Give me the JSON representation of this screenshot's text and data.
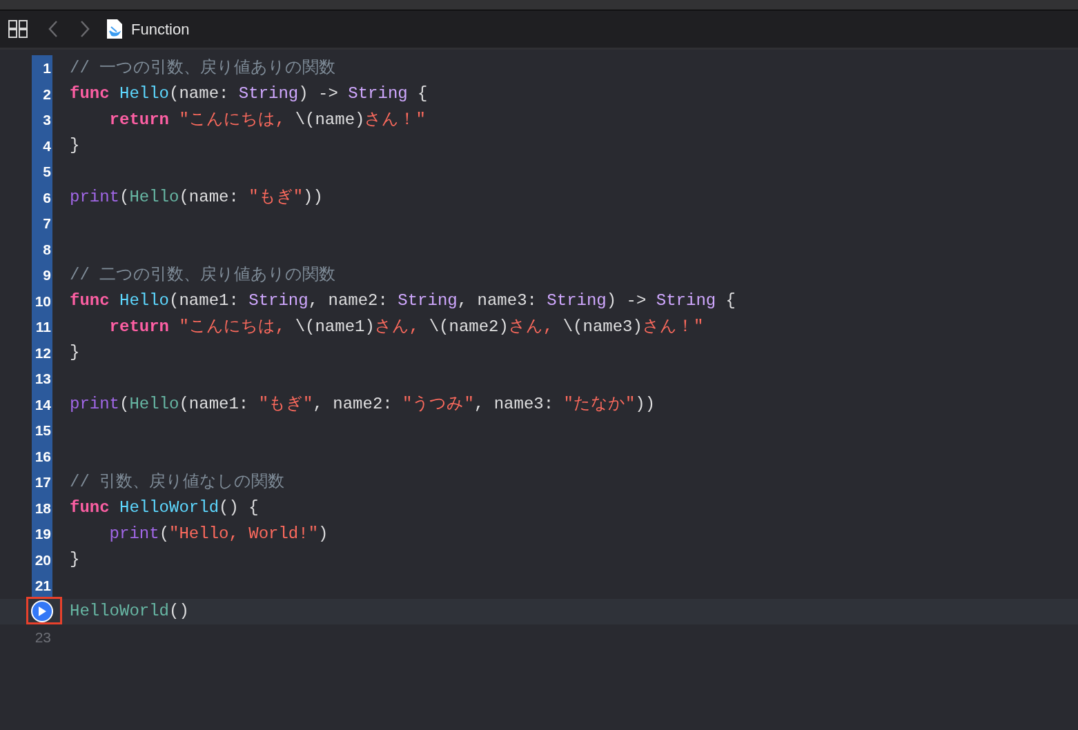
{
  "toolbar": {
    "title": "Function"
  },
  "lines": [
    {
      "number": "1",
      "executed": true,
      "kind": "number",
      "tokens": [
        {
          "kind": "comment",
          "text": "// 一つの引数、戻り値ありの関数"
        }
      ]
    },
    {
      "number": "2",
      "executed": true,
      "kind": "number",
      "tokens": [
        {
          "kind": "keyword",
          "text": "func"
        },
        {
          "kind": "decl",
          "text": " Hello"
        },
        {
          "kind": "plain",
          "text": "(name: "
        },
        {
          "kind": "type",
          "text": "String"
        },
        {
          "kind": "plain",
          "text": ") -> "
        },
        {
          "kind": "type",
          "text": "String"
        },
        {
          "kind": "plain",
          "text": " {"
        }
      ]
    },
    {
      "number": "3",
      "executed": true,
      "kind": "number",
      "tokens": [
        {
          "kind": "keyword",
          "text": "    return"
        },
        {
          "kind": "string",
          "text": " \"こんにちは, "
        },
        {
          "kind": "plain",
          "text": "\\(name)"
        },
        {
          "kind": "string",
          "text": "さん！\""
        }
      ]
    },
    {
      "number": "4",
      "executed": true,
      "kind": "number",
      "tokens": [
        {
          "kind": "plain",
          "text": "}"
        }
      ]
    },
    {
      "number": "5",
      "executed": true,
      "kind": "number"
    },
    {
      "number": "6",
      "executed": true,
      "kind": "number",
      "tokens": [
        {
          "kind": "builtin",
          "text": "print"
        },
        {
          "kind": "plain",
          "text": "("
        },
        {
          "kind": "call",
          "text": "Hello"
        },
        {
          "kind": "plain",
          "text": "(name: "
        },
        {
          "kind": "string",
          "text": "\"もぎ\""
        },
        {
          "kind": "plain",
          "text": "))"
        }
      ]
    },
    {
      "number": "7",
      "executed": true,
      "kind": "number"
    },
    {
      "number": "8",
      "executed": true,
      "kind": "number"
    },
    {
      "number": "9",
      "executed": true,
      "kind": "number",
      "tokens": [
        {
          "kind": "comment",
          "text": "// 二つの引数、戻り値ありの関数"
        }
      ]
    },
    {
      "number": "10",
      "executed": true,
      "kind": "number",
      "tokens": [
        {
          "kind": "keyword",
          "text": "func"
        },
        {
          "kind": "decl",
          "text": " Hello"
        },
        {
          "kind": "plain",
          "text": "(name1: "
        },
        {
          "kind": "type",
          "text": "String"
        },
        {
          "kind": "plain",
          "text": ", name2: "
        },
        {
          "kind": "type",
          "text": "String"
        },
        {
          "kind": "plain",
          "text": ", name3: "
        },
        {
          "kind": "type",
          "text": "String"
        },
        {
          "kind": "plain",
          "text": ") -> "
        },
        {
          "kind": "type",
          "text": "String"
        },
        {
          "kind": "plain",
          "text": " {"
        }
      ]
    },
    {
      "number": "11",
      "executed": true,
      "kind": "number",
      "tokens": [
        {
          "kind": "keyword",
          "text": "    return"
        },
        {
          "kind": "string",
          "text": " \"こんにちは, "
        },
        {
          "kind": "plain",
          "text": "\\(name1)"
        },
        {
          "kind": "string",
          "text": "さん, "
        },
        {
          "kind": "plain",
          "text": "\\(name2)"
        },
        {
          "kind": "string",
          "text": "さん, "
        },
        {
          "kind": "plain",
          "text": "\\(name3)"
        },
        {
          "kind": "string",
          "text": "さん！\""
        }
      ]
    },
    {
      "number": "12",
      "executed": true,
      "kind": "number",
      "tokens": [
        {
          "kind": "plain",
          "text": "}"
        }
      ]
    },
    {
      "number": "13",
      "executed": true,
      "kind": "number"
    },
    {
      "number": "14",
      "executed": true,
      "kind": "number",
      "tokens": [
        {
          "kind": "builtin",
          "text": "print"
        },
        {
          "kind": "plain",
          "text": "("
        },
        {
          "kind": "call",
          "text": "Hello"
        },
        {
          "kind": "plain",
          "text": "(name1: "
        },
        {
          "kind": "string",
          "text": "\"もぎ\""
        },
        {
          "kind": "plain",
          "text": ", name2: "
        },
        {
          "kind": "string",
          "text": "\"うつみ\""
        },
        {
          "kind": "plain",
          "text": ", name3: "
        },
        {
          "kind": "string",
          "text": "\"たなか\""
        },
        {
          "kind": "plain",
          "text": "))"
        }
      ]
    },
    {
      "number": "15",
      "executed": true,
      "kind": "number"
    },
    {
      "number": "16",
      "executed": true,
      "kind": "number"
    },
    {
      "number": "17",
      "executed": true,
      "kind": "number",
      "tokens": [
        {
          "kind": "comment",
          "text": "// 引数、戻り値なしの関数"
        }
      ]
    },
    {
      "number": "18",
      "executed": true,
      "kind": "number",
      "tokens": [
        {
          "kind": "keyword",
          "text": "func"
        },
        {
          "kind": "decl",
          "text": " HelloWorld"
        },
        {
          "kind": "plain",
          "text": "() {"
        }
      ]
    },
    {
      "number": "19",
      "executed": true,
      "kind": "number",
      "tokens": [
        {
          "kind": "builtin",
          "text": "    print"
        },
        {
          "kind": "plain",
          "text": "("
        },
        {
          "kind": "string",
          "text": "\"Hello, World!\""
        },
        {
          "kind": "plain",
          "text": ")"
        }
      ]
    },
    {
      "number": "20",
      "executed": true,
      "kind": "number",
      "tokens": [
        {
          "kind": "plain",
          "text": "}"
        }
      ]
    },
    {
      "number": "21",
      "executed": true,
      "kind": "number"
    },
    {
      "executed": false,
      "kind": "run",
      "tokens": [
        {
          "kind": "call",
          "text": "HelloWorld"
        },
        {
          "kind": "plain",
          "text": "()"
        }
      ]
    },
    {
      "number": "23",
      "executed": false,
      "kind": "number"
    }
  ]
}
